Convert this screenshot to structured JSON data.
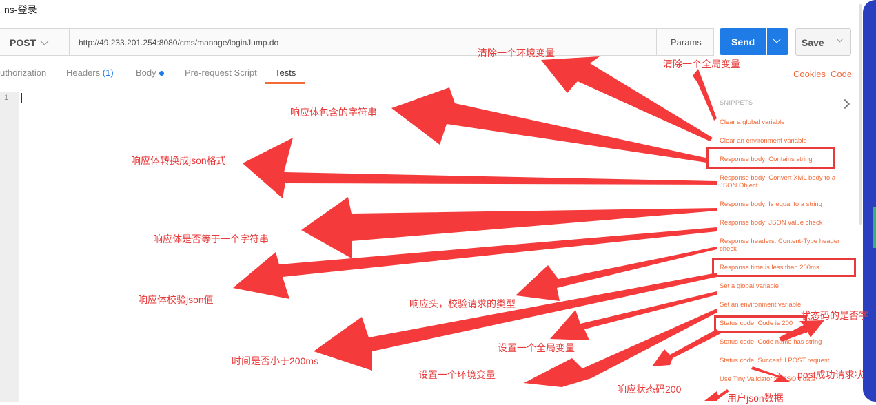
{
  "window": {
    "title": "ns-登录"
  },
  "request": {
    "method": "POST",
    "url": "http://49.233.201.254:8080/cms/manage/loginJump.do",
    "params_label": "Params",
    "send_label": "Send",
    "save_label": "Save"
  },
  "tabs": [
    {
      "label": "uthorization"
    },
    {
      "label": "Headers"
    },
    {
      "label": "Body"
    },
    {
      "label": "Pre-request Script"
    },
    {
      "label": "Tests"
    }
  ],
  "headers_count": "(1)",
  "right_links": {
    "cookies": "Cookies",
    "code": "Code"
  },
  "editor": {
    "line_number": "1"
  },
  "snippets": {
    "heading": "SNIPPETS",
    "items": [
      "Clear a global variable",
      "Clear an environment variable",
      "Response body: Contains string",
      "Response body: Convert XML body to a JSON Object",
      "Response body: Is equal to a string",
      "Response body: JSON value check",
      "Response headers: Content-Type header check",
      "Response time is less than 200ms",
      "Set a global variable",
      "Set an environment variable",
      "Status code: Code is 200",
      "Status code: Code name has string",
      "Status code: Succesful POST request",
      "Use Tiny Validator for JSON data"
    ]
  },
  "annotations": [
    "清除一个环境变量",
    "清除一个全局变量",
    "响应体包含的字符串",
    "响应体转换成json格式",
    "响应体是否等于一个字符串",
    "响应体校验json值",
    "响应头，校验请求的类型",
    "状态码的是否字",
    "设置一个全局变量",
    "时间是否小于200ms",
    "设置一个环境变量",
    "post成功请求状",
    "响应状态码200",
    "用户json数据"
  ],
  "colors": {
    "accent": "#f26b3a",
    "send": "#1f7be6",
    "annotation": "#e83a3a"
  }
}
